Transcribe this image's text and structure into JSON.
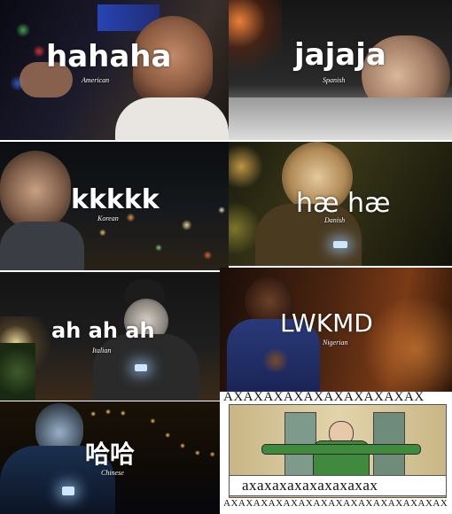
{
  "panels": [
    {
      "laugh": "hahaha",
      "language": "American"
    },
    {
      "laugh": "jajaja",
      "language": "Spanish"
    },
    {
      "laugh": "kkkkk",
      "language": "Korean"
    },
    {
      "laugh": "hæ hæ",
      "language": "Danish"
    },
    {
      "laugh": "ah ah ah",
      "language": "Italian"
    },
    {
      "laugh": "LWKMD",
      "language": "Nigerian"
    },
    {
      "laugh": "哈哈",
      "language": "Chinese"
    }
  ],
  "greek_panel": {
    "top_text": "AXAXAXAXAXAXAXAXAXAX",
    "caption": "axaxaxaxaxaxaxaxax",
    "bottom_text": "AXAXAXAXAXAXAXAXAXAXAXAXAXAXAX"
  }
}
